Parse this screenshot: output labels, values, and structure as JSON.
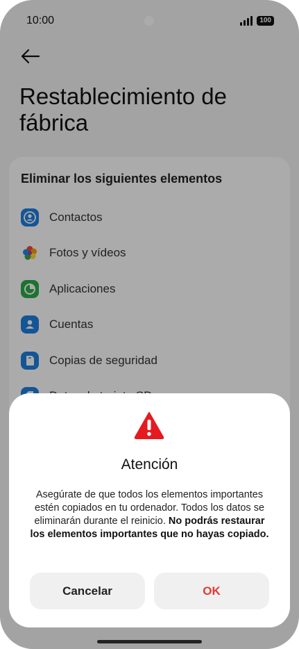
{
  "status": {
    "time": "10:00",
    "battery": "100"
  },
  "page": {
    "title": "Restablecimiento de fábrica"
  },
  "card": {
    "heading": "Eliminar los siguientes elementos",
    "items": [
      {
        "label": "Contactos",
        "icon": "contacts-icon"
      },
      {
        "label": "Fotos y vídeos",
        "icon": "photos-icon"
      },
      {
        "label": "Aplicaciones",
        "icon": "apps-icon"
      },
      {
        "label": "Cuentas",
        "icon": "accounts-icon"
      },
      {
        "label": "Copias de seguridad",
        "icon": "backup-icon"
      },
      {
        "label": "Datos de tarjeta SD",
        "icon": "sd-card-icon"
      }
    ]
  },
  "dialog": {
    "title": "Atención",
    "body_text": "Asegúrate de que todos los elementos importantes estén copiados en tu ordenador. Todos los datos se eliminarán durante el reinicio.",
    "body_bold": "No podrás restaurar los elementos importantes que no hayas copiado.",
    "cancel_label": "Cancelar",
    "ok_label": "OK"
  },
  "colors": {
    "accent_ok": "#e53935",
    "warning": "#e5191f",
    "blue": "#1f7fe0"
  }
}
